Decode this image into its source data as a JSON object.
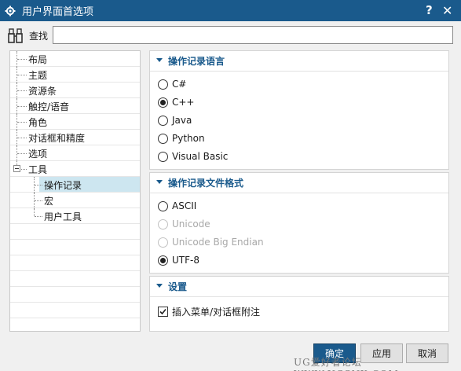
{
  "window": {
    "title": "用户界面首选项",
    "help_label": "?",
    "close_label": "✕"
  },
  "search": {
    "label": "查找",
    "value": "",
    "placeholder": ""
  },
  "tree": {
    "items": [
      {
        "label": "布局"
      },
      {
        "label": "主题"
      },
      {
        "label": "资源条"
      },
      {
        "label": "触控/语音"
      },
      {
        "label": "角色"
      },
      {
        "label": "对话框和精度"
      },
      {
        "label": "选项"
      },
      {
        "label": "工具"
      },
      {
        "label": "操作记录"
      },
      {
        "label": "宏"
      },
      {
        "label": "用户工具"
      }
    ]
  },
  "sections": {
    "language": {
      "title": "操作记录语言",
      "options": [
        {
          "label": "C#"
        },
        {
          "label": "C++"
        },
        {
          "label": "Java"
        },
        {
          "label": "Python"
        },
        {
          "label": "Visual Basic"
        }
      ],
      "selected": "C++"
    },
    "format": {
      "title": "操作记录文件格式",
      "options": [
        {
          "label": "ASCII"
        },
        {
          "label": "Unicode"
        },
        {
          "label": "Unicode Big Endian"
        },
        {
          "label": "UTF-8"
        }
      ],
      "selected": "UTF-8"
    },
    "settings": {
      "title": "设置",
      "checkbox_label": "插入菜单/对话框附注",
      "checked": true
    }
  },
  "buttons": {
    "ok": "确定",
    "apply": "应用",
    "cancel": "取消"
  },
  "watermark": "UG爱好者论坛 WWW.UGSNX.COM",
  "colors": {
    "accent": "#1a5a8c",
    "selection": "#cde6f0"
  }
}
